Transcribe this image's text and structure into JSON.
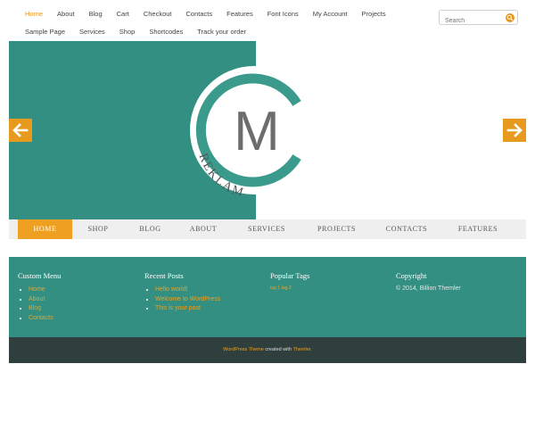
{
  "topnav": {
    "row1": [
      "Home",
      "About",
      "Blog",
      "Cart",
      "Checkout",
      "Contacts",
      "Features",
      "Font Icons",
      "My Account",
      "Projects"
    ],
    "row2": [
      "Sample Page",
      "Services",
      "Shop",
      "Shortcodes",
      "Track your order"
    ],
    "active": "Home"
  },
  "search": {
    "placeholder": "Search"
  },
  "slider": {
    "logo_letter": "M",
    "logo_text": "REKLAM"
  },
  "mainmenu": [
    "HOME",
    "SHOP",
    "BLOG",
    "ABOUT",
    "SERVICES",
    "PROJECTS",
    "CONTACTS",
    "FEATURES"
  ],
  "footer": {
    "custom_menu": {
      "title": "Custom Menu",
      "items": [
        "Home",
        "About",
        "Blog",
        "Contacts"
      ]
    },
    "recent_posts": {
      "title": "Recent Posts",
      "items": [
        "Hello world!",
        "Welcome to WordPress",
        "This is your post"
      ]
    },
    "popular_tags": {
      "title": "Popular Tags",
      "tags": "tag 1 tag 2"
    },
    "copyright": {
      "title": "Copyright",
      "text": "© 2014, Billion Themler"
    }
  },
  "bottombar": {
    "link1": "WordPress Theme",
    "middle": " created with ",
    "link2": "Themler."
  },
  "colors": {
    "accent": "#f0a020",
    "teal": "#338f82",
    "dark": "#2f3f3d"
  },
  "icons": {
    "search": "search-icon",
    "prev": "arrow-left-icon",
    "next": "arrow-right-icon"
  }
}
